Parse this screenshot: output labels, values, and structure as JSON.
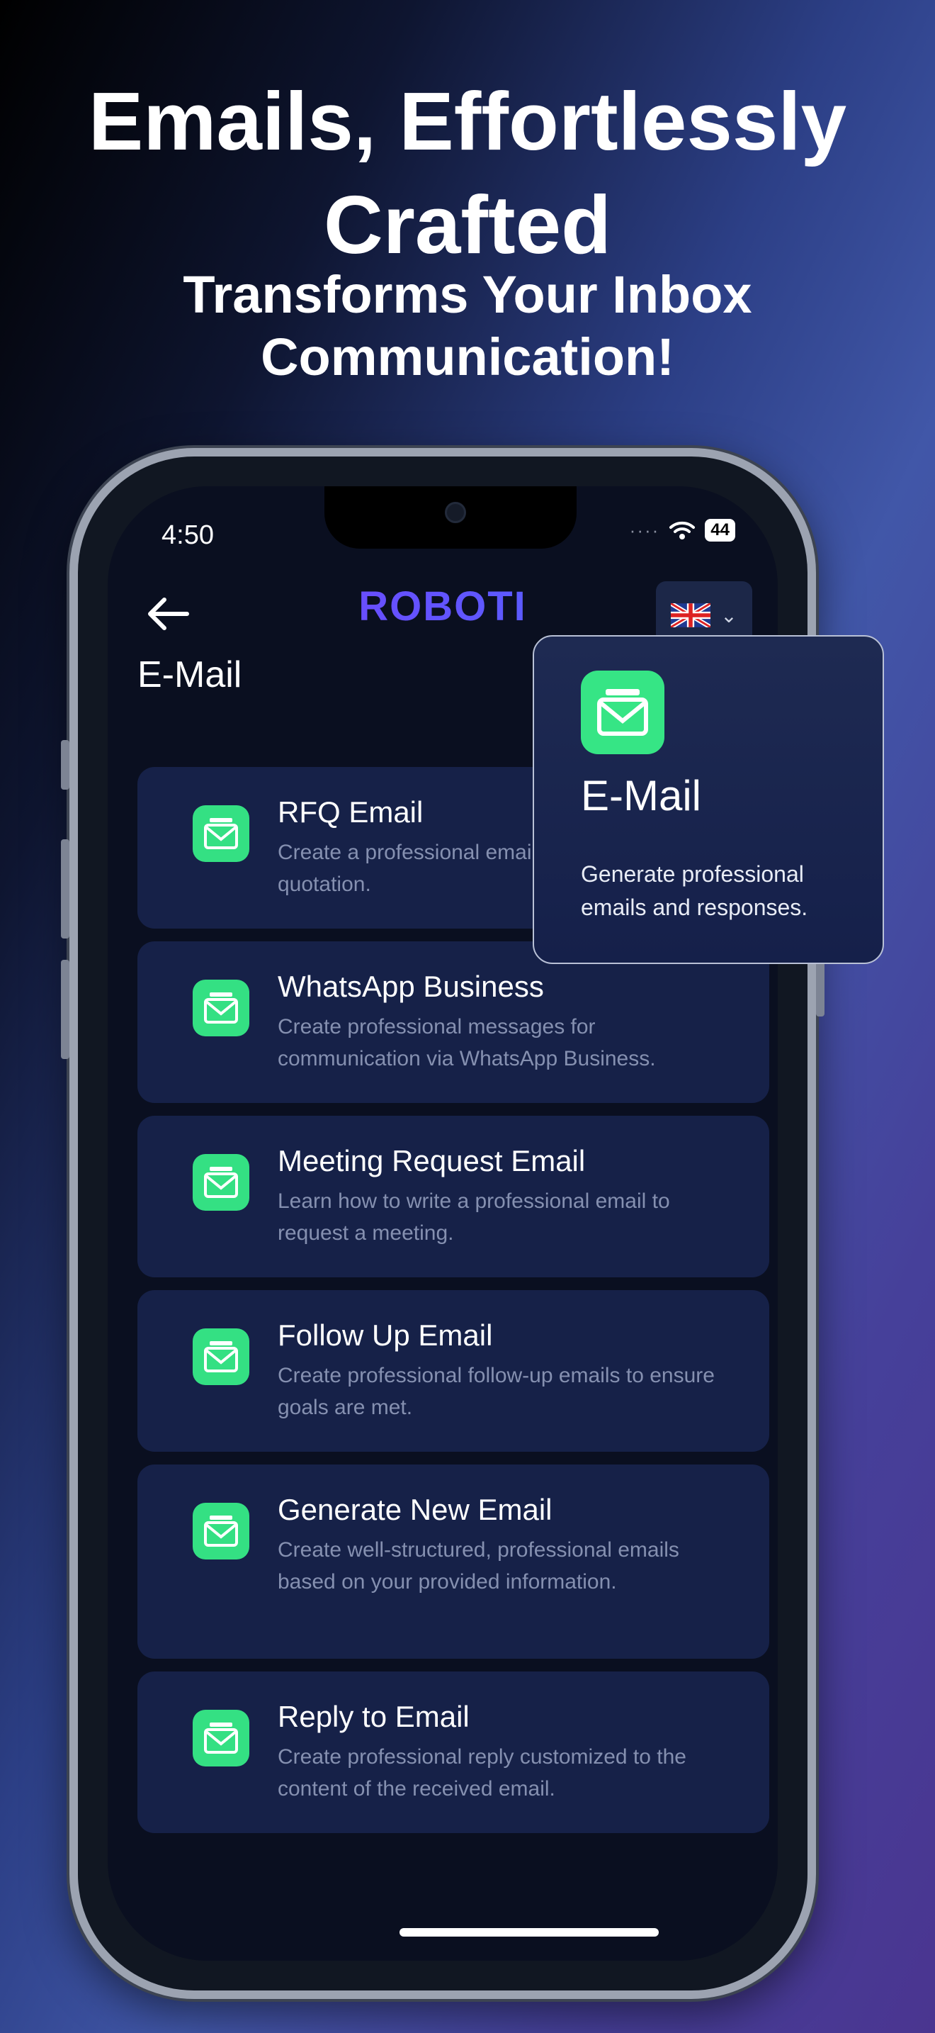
{
  "headline": {
    "title_line1": "Emails, Effortlessly",
    "title_line2": "Crafted",
    "subtitle_line1": "Transforms Your Inbox",
    "subtitle_line2": "Communication!"
  },
  "status_bar": {
    "time": "4:50",
    "battery": "44",
    "signal": "····"
  },
  "header": {
    "logo": "ROBOTI",
    "language_flag": "uk-flag-icon"
  },
  "page": {
    "title": "E-Mail"
  },
  "cards": [
    {
      "title": "RFQ Email",
      "desc": "Create a professional email for requesting a quotation."
    },
    {
      "title": "WhatsApp Business",
      "desc": "Create professional messages for communication via WhatsApp Business."
    },
    {
      "title": "Meeting Request Email",
      "desc": "Learn how to write a professional email to request a meeting."
    },
    {
      "title": "Follow Up Email",
      "desc": "Create professional follow-up emails to ensure goals are met."
    },
    {
      "title": "Generate New Email",
      "desc": "Create well-structured, professional emails based on your provided information."
    },
    {
      "title": "Reply to Email",
      "desc": "Create professional reply customized to the content of the received email."
    }
  ],
  "popup": {
    "title": "E-Mail",
    "desc": "Generate professional emails and responses."
  },
  "colors": {
    "accent_green": "#34e083",
    "card_bg": "#162148",
    "screen_bg": "#0a0f20"
  }
}
